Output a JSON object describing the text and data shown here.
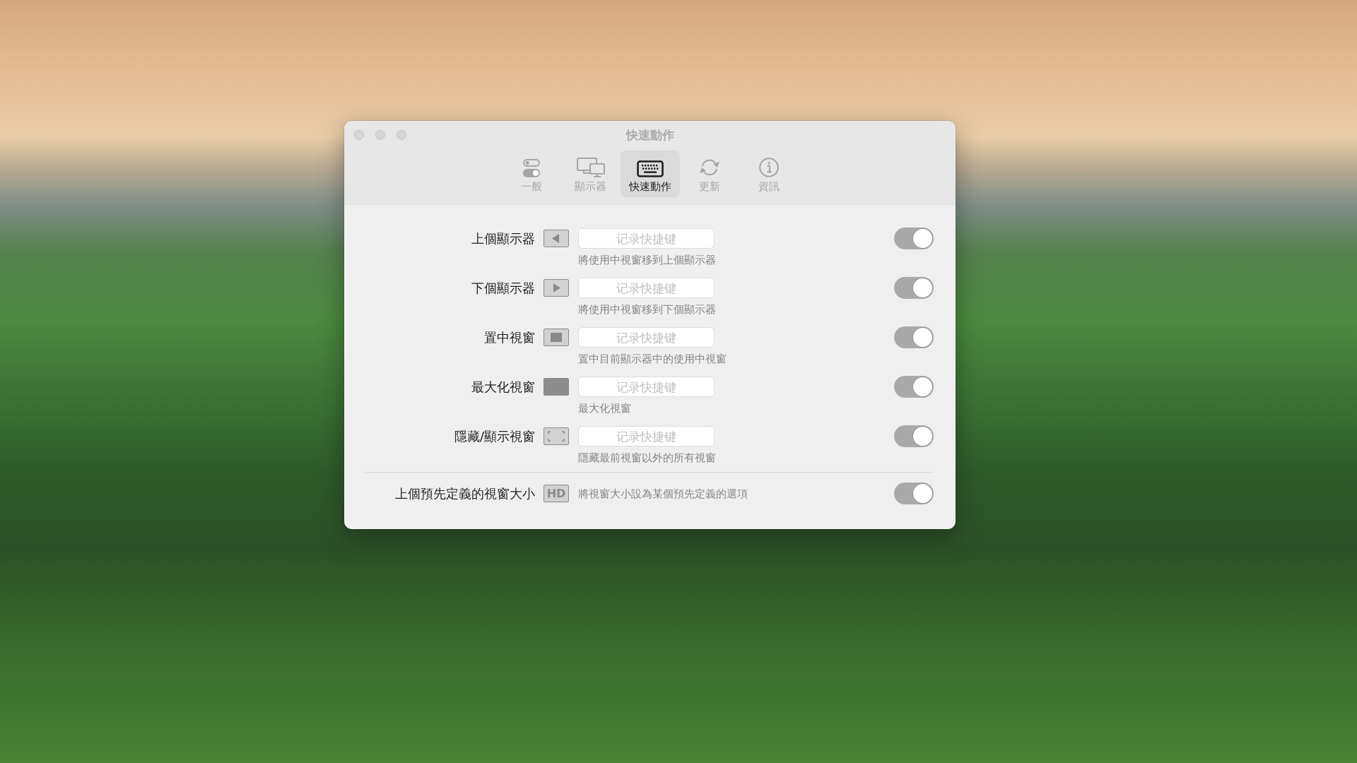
{
  "window": {
    "title": "快速動作",
    "focused": false
  },
  "tabs": [
    {
      "label": "一般",
      "selected": false
    },
    {
      "label": "顯示器",
      "selected": false
    },
    {
      "label": "快速動作",
      "selected": true
    },
    {
      "label": "更新",
      "selected": false
    },
    {
      "label": "資訊",
      "selected": false
    }
  ],
  "rows": [
    {
      "kind": "shortcut",
      "label": "上個顯示器",
      "placeholder": "记录快捷键",
      "description": "將使用中視窗移到上個顯示器",
      "on": true
    },
    {
      "kind": "shortcut",
      "label": "下個顯示器",
      "placeholder": "记录快捷键",
      "description": "將使用中視窗移到下個顯示器",
      "on": true
    },
    {
      "kind": "shortcut",
      "label": "置中視窗",
      "placeholder": "记录快捷键",
      "description": "置中目前顯示器中的使用中視窗",
      "on": true
    },
    {
      "kind": "shortcut",
      "label": "最大化視窗",
      "placeholder": "记录快捷键",
      "description": "最大化視窗",
      "on": true
    },
    {
      "kind": "shortcut",
      "label": "隱藏/顯示視窗",
      "placeholder": "记录快捷键",
      "description": "隱藏最前視窗以外的所有視窗",
      "on": true
    },
    {
      "kind": "preset",
      "label": "上個預先定義的視窗大小",
      "badge": "HD",
      "description": "將視窗大小設為某個預先定義的選項",
      "on": true
    }
  ]
}
